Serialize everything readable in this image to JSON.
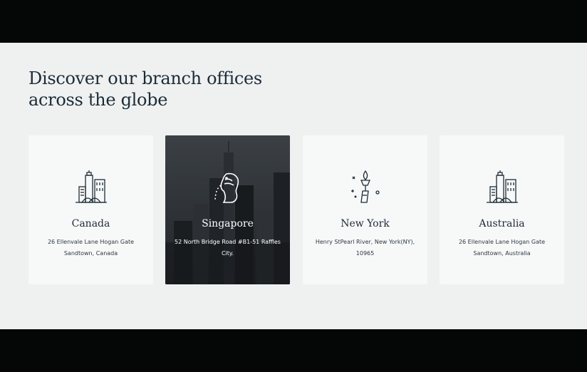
{
  "heading": {
    "line1": "Discover our branch offices",
    "line2": "across the globe"
  },
  "offices": [
    {
      "city": "Canada",
      "address": "26 Ellenvale Lane Hogan Gate Sandtown, Canada",
      "icon": "city-buildings-icon"
    },
    {
      "city": "Singapore",
      "address": "52 North Bridge Road #B1-51 Raffles City.",
      "icon": "merlion-icon",
      "highlighted": true
    },
    {
      "city": "New York",
      "address": "Henry StPearl River, New York(NY), 10965",
      "icon": "statue-of-liberty-torch-icon"
    },
    {
      "city": "Australia",
      "address": "26 Ellenvale Lane Hogan Gate Sandtown, Australia",
      "icon": "city-buildings-icon"
    }
  ],
  "colors": {
    "section_bg": "#eef1f0",
    "card_bg": "#f7f8f8",
    "text": "#1c2c36"
  }
}
